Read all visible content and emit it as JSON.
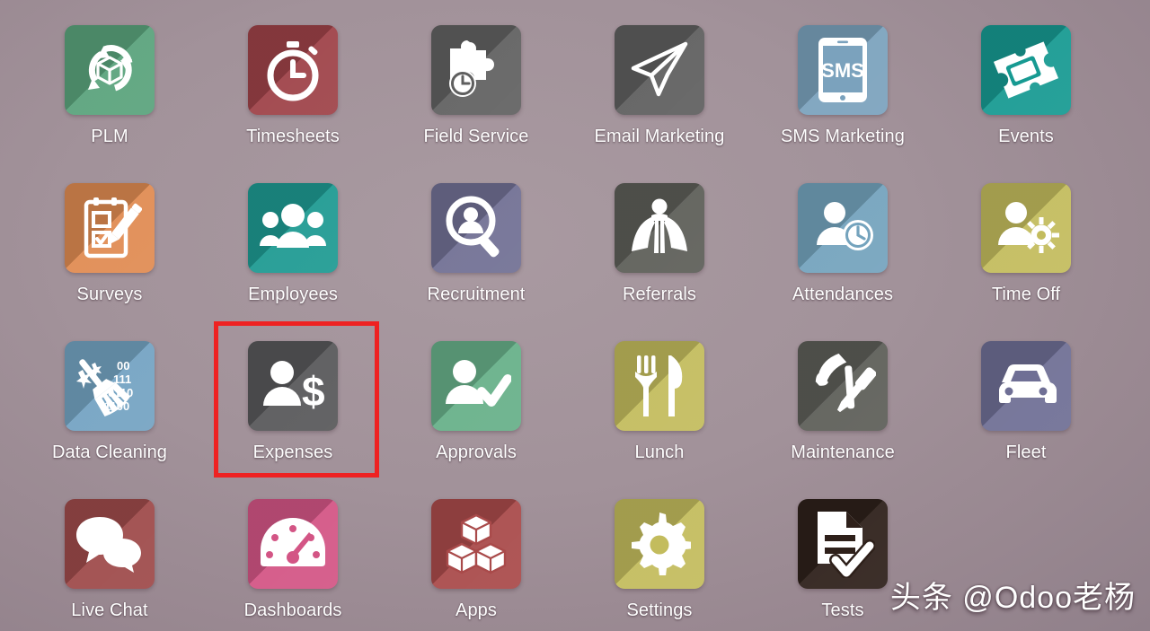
{
  "background": {
    "color": "#a2929a"
  },
  "highlight": {
    "color": "#ee2222",
    "target_app": "Expenses"
  },
  "watermark": {
    "text": "头条 @Odoo老杨"
  },
  "apps": [
    {
      "label": "PLM",
      "icon": "recycle-cube-icon",
      "color": "#5aa37c"
    },
    {
      "label": "Timesheets",
      "icon": "stopwatch-icon",
      "color": "#9e4248"
    },
    {
      "label": "Field Service",
      "icon": "puzzle-clock-icon",
      "color": "#616161"
    },
    {
      "label": "Email Marketing",
      "icon": "paper-plane-icon",
      "color": "#5f5f5f"
    },
    {
      "label": "SMS Marketing",
      "icon": "phone-sms-icon",
      "color": "#7ba2bd"
    },
    {
      "label": "Events",
      "icon": "ticket-icon",
      "color": "#179a92"
    },
    {
      "label": "Surveys",
      "icon": "clipboard-pencil-icon",
      "color": "#e08b52"
    },
    {
      "label": "Employees",
      "icon": "people-group-icon",
      "color": "#1e9a92"
    },
    {
      "label": "Recruitment",
      "icon": "magnifier-person-icon",
      "color": "#717094"
    },
    {
      "label": "Referrals",
      "icon": "superhero-icon",
      "color": "#5d5e58"
    },
    {
      "label": "Attendances",
      "icon": "person-clock-icon",
      "color": "#74a3bd"
    },
    {
      "label": "Time Off",
      "icon": "person-sun-icon",
      "color": "#c3bc5d"
    },
    {
      "label": "Data Cleaning",
      "icon": "broom-binary-icon",
      "color": "#74a3c2"
    },
    {
      "label": "Expenses",
      "icon": "person-dollar-icon",
      "color": "#58585a"
    },
    {
      "label": "Approvals",
      "icon": "person-check-icon",
      "color": "#67b089"
    },
    {
      "label": "Lunch",
      "icon": "fork-knife-icon",
      "color": "#c3bc5d"
    },
    {
      "label": "Maintenance",
      "icon": "hammer-screwdriver-icon",
      "color": "#5d5e58"
    },
    {
      "label": "Fleet",
      "icon": "car-icon",
      "color": "#6f6f95"
    },
    {
      "label": "Live Chat",
      "icon": "speech-bubbles-icon",
      "color": "#9e4a4a"
    },
    {
      "label": "Dashboards",
      "icon": "gauge-icon",
      "color": "#d35585"
    },
    {
      "label": "Apps",
      "icon": "blocks-icon",
      "color": "#a94a4a"
    },
    {
      "label": "Settings",
      "icon": "gear-icon",
      "color": "#c3bc5d"
    },
    {
      "label": "Tests",
      "icon": "document-check-icon",
      "color": "#2e201a"
    }
  ]
}
